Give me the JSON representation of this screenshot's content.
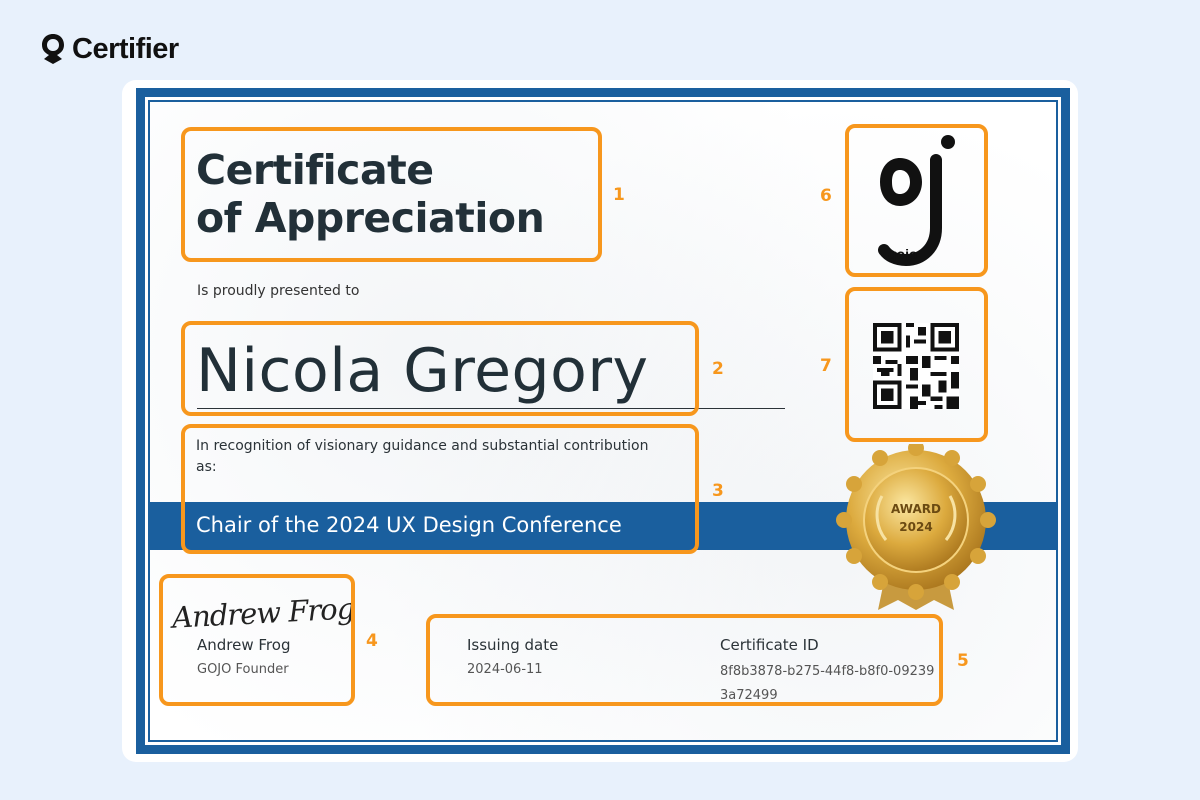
{
  "brand": {
    "name": "Certifier",
    "icon": "certifier-logo-icon"
  },
  "certificate": {
    "title_line1": "Certificate",
    "title_line2": "of Appreciation",
    "presented_text": "Is proudly presented to",
    "recipient": "Nicola Gregory",
    "recognition_text": "In recognition of visionary guidance and substantial contribution as:",
    "role": "Chair of the 2024 UX Design Conference",
    "signature_script": "Andrew Frog",
    "signer_name": "Andrew Frog",
    "signer_title": "GOJO Founder",
    "issue_label": "Issuing date",
    "issue_date": "2024-06-11",
    "id_label": "Certificate ID",
    "certificate_id": "8f8b3878-b275-44f8-b8f0-092393a72499",
    "logo_text": "gojo",
    "seal_line1": "AWARD",
    "seal_line2": "2024"
  },
  "callouts": [
    "1",
    "2",
    "3",
    "4",
    "5",
    "6",
    "7"
  ],
  "colors": {
    "frame": "#1a5f9e",
    "highlight": "#f7971d",
    "background": "#e8f1fc",
    "gold": "#d9a63a"
  },
  "icons": {
    "qr": "qr-code-icon",
    "seal": "award-seal-icon",
    "logo": "gojo-logo-icon"
  }
}
